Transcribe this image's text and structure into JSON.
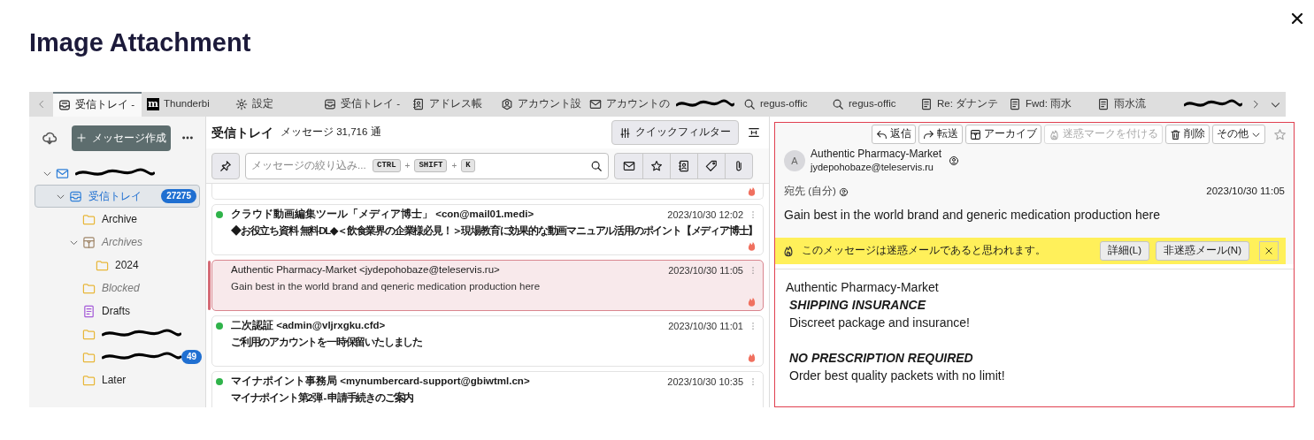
{
  "dialog": {
    "title": "Image Attachment"
  },
  "tabs": [
    {
      "kind": "inbox",
      "label": "受信トレイ -",
      "selected": true
    },
    {
      "kind": "logo",
      "logo_letter": "m",
      "label": "Thunderbi",
      "selected": false
    },
    {
      "kind": "settings",
      "label": "設定",
      "selected": false
    },
    {
      "kind": "inbox",
      "label": "受信トレイ -",
      "selected": false
    },
    {
      "kind": "address-book",
      "label": "アドレス帳",
      "selected": false
    },
    {
      "kind": "account",
      "label": "アカウント設",
      "selected": false
    },
    {
      "kind": "mail-account",
      "label": "アカウントの",
      "selected": false
    },
    {
      "kind": "redacted",
      "selected": false
    },
    {
      "kind": "search",
      "label": "regus-offic",
      "selected": false
    },
    {
      "kind": "search",
      "label": "regus-offic",
      "selected": false
    },
    {
      "kind": "document",
      "label": "Re: ダナンテ",
      "selected": false
    },
    {
      "kind": "document",
      "label": "Fwd: 雨水",
      "selected": false
    },
    {
      "kind": "document",
      "label": "雨水流",
      "selected": false
    },
    {
      "kind": "redacted",
      "selected": false
    }
  ],
  "sidebar": {
    "compose_label": "メッセージ作成",
    "folders": [
      {
        "kind": "account",
        "redacted": true,
        "selected": false,
        "expanded": true,
        "children": [
          {
            "kind": "inbox",
            "label": "受信トレイ",
            "badge": "27275",
            "selected": true,
            "expanded": true,
            "children": [
              {
                "kind": "folder",
                "label": "Archive",
                "selected": false
              },
              {
                "kind": "archives",
                "label": "Archives",
                "dimmed": true,
                "selected": false,
                "expanded": true,
                "children": [
                  {
                    "kind": "folder",
                    "label": "2024",
                    "selected": false
                  }
                ]
              },
              {
                "kind": "folder",
                "label": "Blocked",
                "dimmed": true,
                "selected": false
              },
              {
                "kind": "drafts",
                "label": "Drafts",
                "selected": false
              },
              {
                "kind": "folder",
                "redacted": true,
                "selected": false
              },
              {
                "kind": "folder",
                "redacted": true,
                "badge": "49",
                "selected": false
              },
              {
                "kind": "folder",
                "label": "Later",
                "selected": false
              }
            ]
          }
        ]
      }
    ]
  },
  "message_list": {
    "folder_name": "受信トレイ",
    "count": "メッセージ 31,716 通",
    "quick_filter_label": "クイックフィルター",
    "search": {
      "placeholder": "メッセージの絞り込み...",
      "shortcut_keys": [
        "CTRL",
        "SHIFT",
        "K"
      ],
      "key_joiner": "+"
    },
    "messages": [
      {
        "kind": "clipped",
        "junk": true,
        "selected": false
      },
      {
        "kind": "full",
        "sender": "クラウド動画編集ツール「メディア博士」 <con@mail01.medi>",
        "date": "2023/10/30 12:02",
        "subject": "◆お役立ち資料 無料DL◆＜飲食業界の企業様必見！＞現場教育に効果的な動画マニュアル活用のポイント【メディア博士】",
        "unread": true,
        "junk": true,
        "selected": false
      },
      {
        "kind": "full",
        "sender": "Authentic Pharmacy-Market <jydepohobaze@teleservis.ru>",
        "date": "2023/10/30 11:05",
        "subject": "Gain best in the world brand and qeneric medication production here",
        "unread": false,
        "junk": true,
        "selected": true
      },
      {
        "kind": "full",
        "sender": "二次認証 <admin@vljrxgku.cfd>",
        "date": "2023/10/30 11:01",
        "subject": "ご利用のアカウントを一時保留いたしました",
        "unread": true,
        "junk": true,
        "selected": false
      },
      {
        "kind": "full",
        "sender": "マイナポイント事務局 <mynumbercard-support@gbiwtml.cn>",
        "date": "2023/10/30 10:35",
        "subject": "マイナポイント第2弾 - 申請手続きのご案内",
        "unread": true,
        "selected": false
      }
    ]
  },
  "reader": {
    "actions": [
      {
        "kind": "reply",
        "label": "返信",
        "disabled": false
      },
      {
        "kind": "forward",
        "label": "転送",
        "disabled": false
      },
      {
        "kind": "archive",
        "label": "アーカイブ",
        "disabled": false
      },
      {
        "kind": "junk",
        "label": "迷惑マークを付ける",
        "disabled": true
      },
      {
        "kind": "delete",
        "label": "削除",
        "disabled": false
      },
      {
        "kind": "more",
        "label": "その他",
        "disabled": false
      }
    ],
    "starred": false,
    "avatar_letter": "A",
    "from_name": "Authentic Pharmacy-Market",
    "from_email": "jydepohobaze@teleservis.ru",
    "to": "宛先 (自分)",
    "date": "2023/10/30 11:05",
    "subject": "Gain best in the world brand and generic medication production here",
    "junk_notice": {
      "message": "このメッセージは迷惑メールであると思われます。",
      "buttons": [
        "詳細(L)",
        "非迷惑メール(N)"
      ]
    },
    "body": [
      {
        "kind": "sender",
        "text": "Authentic Pharmacy-Market"
      },
      {
        "kind": "heading",
        "text": "SHIPPING INSURANCE"
      },
      {
        "kind": "line",
        "text": "Discreet package and insurance!"
      },
      {
        "kind": "spacer"
      },
      {
        "kind": "heading",
        "text": "NO PRESCRIPTION REQUIRED"
      },
      {
        "kind": "line",
        "text": "Order best quality packets with no limit!"
      }
    ]
  }
}
